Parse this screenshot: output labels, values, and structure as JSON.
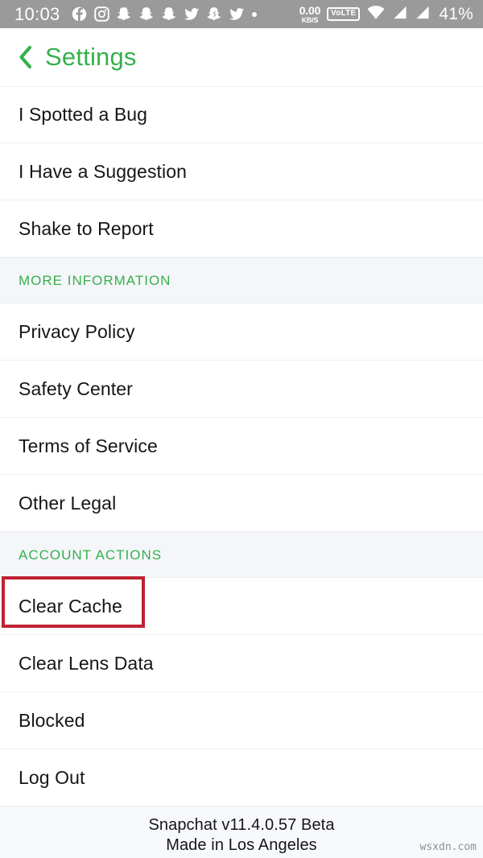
{
  "status_bar": {
    "time": "10:03",
    "icons": [
      "facebook-icon",
      "instagram-icon",
      "snapchat-icon",
      "snapchat-icon",
      "snapchat-icon",
      "twitter-icon",
      "snapchat-ghost-icon",
      "twitter-icon",
      "dot-icon"
    ],
    "network_speed_value": "0.00",
    "network_speed_unit": "KB/S",
    "volte_label": "VoLTE",
    "wifi": "wifi-icon",
    "signal_1": "signal-icon",
    "signal_2": "signal-icon",
    "battery": "41%",
    "background_color": "#9a9a9a"
  },
  "header": {
    "back_icon": "chevron-left-icon",
    "title": "Settings",
    "accent_color": "#34b14c"
  },
  "list": [
    {
      "type": "row",
      "label": "I Spotted a Bug"
    },
    {
      "type": "row",
      "label": "I Have a Suggestion"
    },
    {
      "type": "row",
      "label": "Shake to Report"
    },
    {
      "type": "section",
      "label": "MORE INFORMATION"
    },
    {
      "type": "row",
      "label": "Privacy Policy"
    },
    {
      "type": "row",
      "label": "Safety Center"
    },
    {
      "type": "row",
      "label": "Terms of Service"
    },
    {
      "type": "row",
      "label": "Other Legal"
    },
    {
      "type": "section",
      "label": "ACCOUNT ACTIONS"
    },
    {
      "type": "row",
      "label": "Clear Cache",
      "highlighted": true
    },
    {
      "type": "row",
      "label": "Clear Lens Data"
    },
    {
      "type": "row",
      "label": "Blocked"
    },
    {
      "type": "row",
      "label": "Log Out"
    }
  ],
  "highlight": {
    "target": "Clear Cache",
    "color": "#bf2233"
  },
  "footer": {
    "version_line": "Snapchat v11.4.0.57 Beta",
    "origin_line": "Made in Los Angeles"
  },
  "watermark": {
    "text": "wsxdn.com"
  }
}
